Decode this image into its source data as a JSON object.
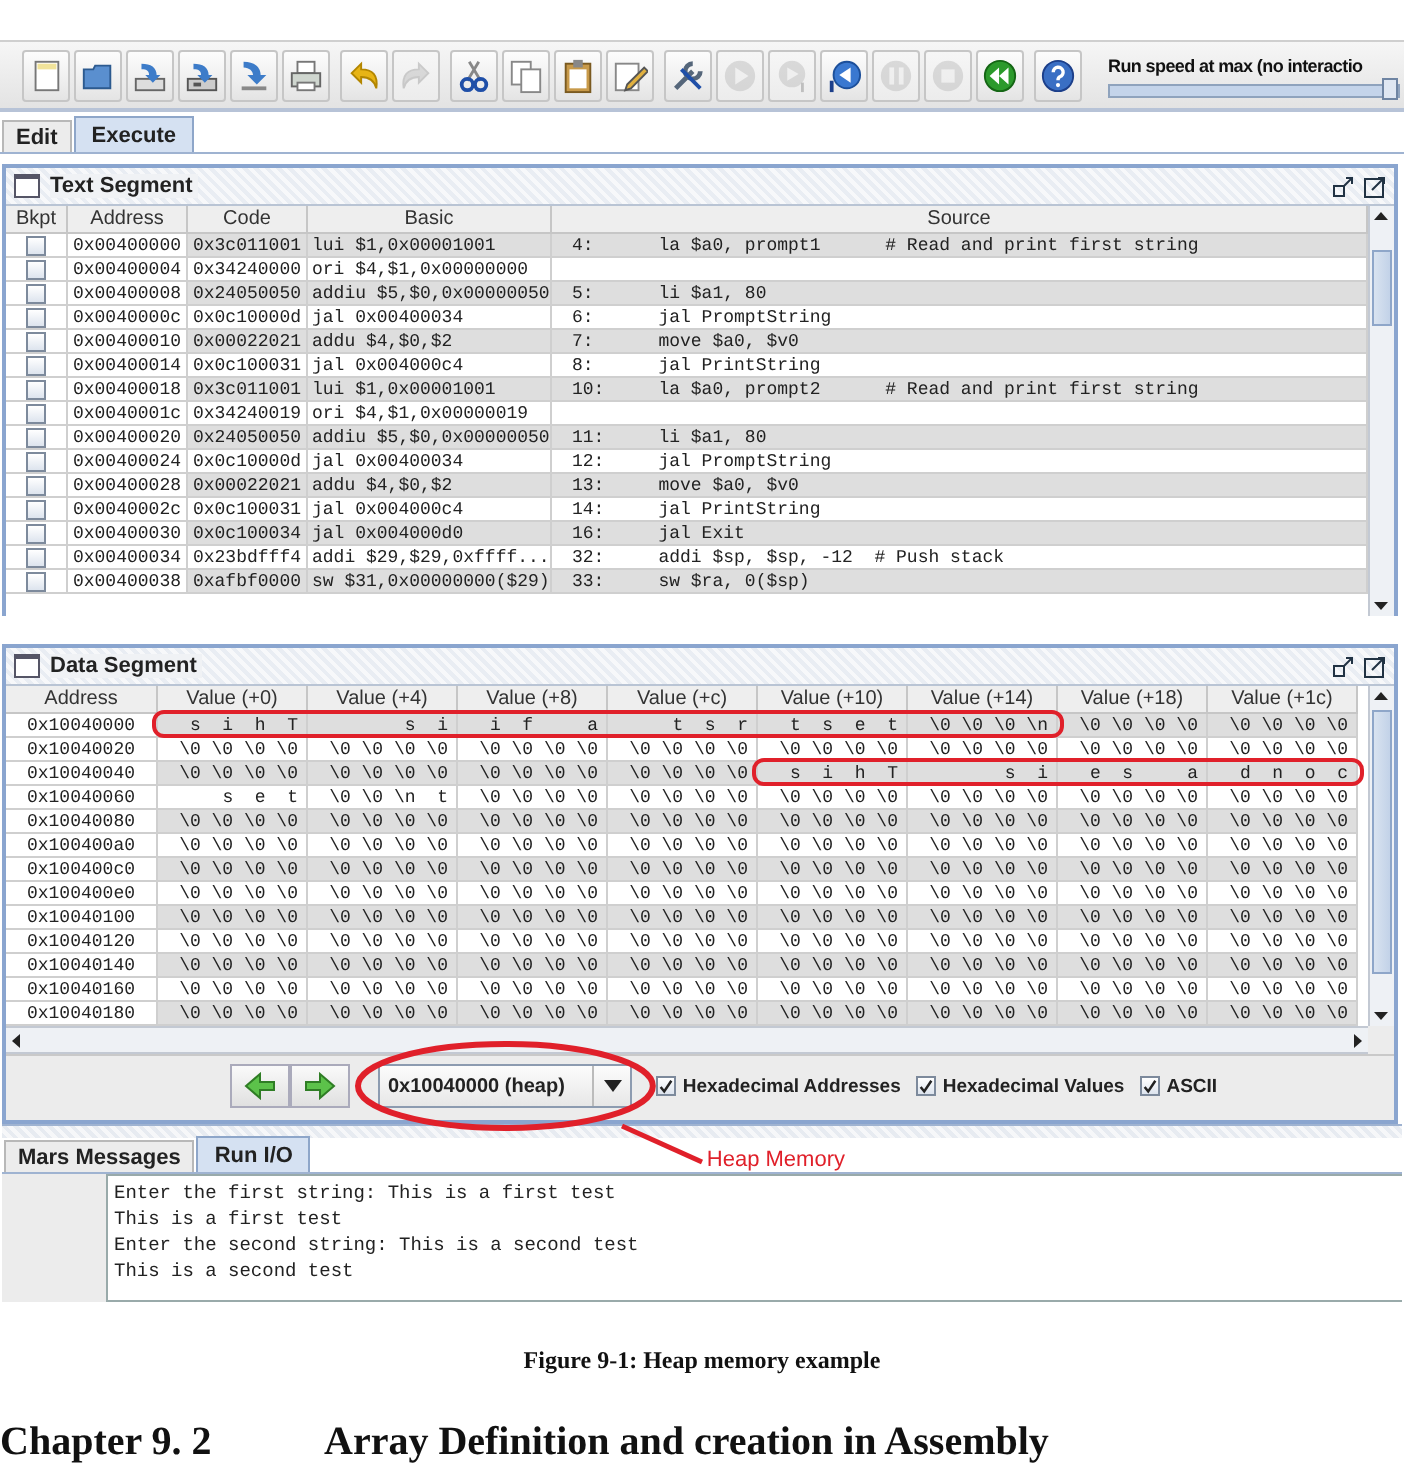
{
  "toolbar": [
    [
      {
        "kind": "new",
        "disabled": false
      },
      {
        "kind": "open",
        "disabled": false
      },
      {
        "kind": "save",
        "disabled": false
      },
      {
        "kind": "save_as",
        "disabled": false
      },
      {
        "kind": "dump",
        "disabled": false
      },
      {
        "kind": "print",
        "disabled": false
      }
    ],
    [
      {
        "kind": "undo",
        "disabled": false
      },
      {
        "kind": "redo",
        "disabled": true
      }
    ],
    [
      {
        "kind": "cut",
        "disabled": false
      },
      {
        "kind": "copy",
        "disabled": false
      },
      {
        "kind": "paste",
        "disabled": false
      },
      {
        "kind": "find",
        "disabled": false
      }
    ],
    [
      {
        "kind": "assemble",
        "disabled": false
      },
      {
        "kind": "run",
        "disabled": true
      },
      {
        "kind": "step",
        "disabled": true
      },
      {
        "kind": "backstep",
        "disabled": false
      },
      {
        "kind": "pause",
        "disabled": true
      },
      {
        "kind": "stop",
        "disabled": true
      },
      {
        "kind": "reset",
        "disabled": false
      }
    ],
    [
      {
        "kind": "help",
        "disabled": false
      }
    ]
  ],
  "speed": {
    "label": "Run speed at max (no interactio",
    "level": 1
  },
  "main_tabs": [
    {
      "label": "Edit",
      "selected": false
    },
    {
      "label": "Execute",
      "selected": true
    }
  ],
  "text_segment": {
    "title": "Text Segment",
    "columns": [
      "Bkpt",
      "Address",
      "Code",
      "Basic",
      "Source"
    ],
    "rows": [
      {
        "breakpoint": false,
        "address": "0x00400000",
        "code": "0x3c011001",
        "basic": "lui $1,0x00001001",
        "source": "4:      la $a0, prompt1      # Read and print first string"
      },
      {
        "breakpoint": false,
        "address": "0x00400004",
        "code": "0x34240000",
        "basic": "ori $4,$1,0x00000000"
      },
      {
        "breakpoint": false,
        "address": "0x00400008",
        "code": "0x24050050",
        "basic": "addiu $5,$0,0x00000050",
        "source": "5:      li $a1, 80"
      },
      {
        "breakpoint": false,
        "address": "0x0040000c",
        "code": "0x0c10000d",
        "basic": "jal 0x00400034",
        "source": "6:      jal PromptString"
      },
      {
        "breakpoint": false,
        "address": "0x00400010",
        "code": "0x00022021",
        "basic": "addu $4,$0,$2",
        "source": "7:      move $a0, $v0"
      },
      {
        "breakpoint": false,
        "address": "0x00400014",
        "code": "0x0c100031",
        "basic": "jal 0x004000c4",
        "source": "8:      jal PrintString"
      },
      {
        "breakpoint": false,
        "address": "0x00400018",
        "code": "0x3c011001",
        "basic": "lui $1,0x00001001",
        "source": "10:     la $a0, prompt2      # Read and print first string"
      },
      {
        "breakpoint": false,
        "address": "0x0040001c",
        "code": "0x34240019",
        "basic": "ori $4,$1,0x00000019"
      },
      {
        "breakpoint": false,
        "address": "0x00400020",
        "code": "0x24050050",
        "basic": "addiu $5,$0,0x00000050",
        "source": "11:     li $a1, 80"
      },
      {
        "breakpoint": false,
        "address": "0x00400024",
        "code": "0x0c10000d",
        "basic": "jal 0x00400034",
        "source": "12:     jal PromptString"
      },
      {
        "breakpoint": false,
        "address": "0x00400028",
        "code": "0x00022021",
        "basic": "addu $4,$0,$2",
        "source": "13:     move $a0, $v0"
      },
      {
        "breakpoint": false,
        "address": "0x0040002c",
        "code": "0x0c100031",
        "basic": "jal 0x004000c4",
        "source": "14:     jal PrintString"
      },
      {
        "breakpoint": false,
        "address": "0x00400030",
        "code": "0x0c100034",
        "basic": "jal 0x004000d0",
        "source": "16:     jal Exit"
      },
      {
        "breakpoint": false,
        "address": "0x00400034",
        "code": "0x23bdfff4",
        "basic": "addi $29,$29,0xffff...",
        "source": "32:     addi $sp, $sp, -12  # Push stack"
      },
      {
        "breakpoint": false,
        "address": "0x00400038",
        "code": "0xafbf0000",
        "basic": "sw $31,0x00000000($29)",
        "source": "33:     sw $ra, 0($sp)"
      }
    ]
  },
  "data_segment": {
    "title": "Data Segment",
    "columns": [
      "Address",
      "Value (+0)",
      "Value (+4)",
      "Value (+8)",
      "Value (+c)",
      "Value (+10)",
      "Value (+14)",
      "Value (+18)",
      "Value (+1c)"
    ],
    "rows": [
      {
        "address": "0x10040000",
        "values": [
          "s  i  h  T",
          "s  i",
          "i  f     a",
          "t  s  r",
          "t  s  e  t",
          "\\0 \\0 \\0 \\n",
          "\\0 \\0 \\0 \\0",
          "\\0 \\0 \\0 \\0"
        ]
      },
      {
        "address": "0x10040020",
        "values": [
          "\\0 \\0 \\0 \\0",
          "\\0 \\0 \\0 \\0",
          "\\0 \\0 \\0 \\0",
          "\\0 \\0 \\0 \\0",
          "\\0 \\0 \\0 \\0",
          "\\0 \\0 \\0 \\0",
          "\\0 \\0 \\0 \\0",
          "\\0 \\0 \\0 \\0"
        ]
      },
      {
        "address": "0x10040040",
        "values": [
          "\\0 \\0 \\0 \\0",
          "\\0 \\0 \\0 \\0",
          "\\0 \\0 \\0 \\0",
          "\\0 \\0 \\0 \\0",
          "s  i  h  T",
          "s  i",
          "e  s     a",
          "d  n  o  c"
        ]
      },
      {
        "address": "0x10040060",
        "values": [
          "s  e  t",
          "\\0 \\0 \\n  t",
          "\\0 \\0 \\0 \\0",
          "\\0 \\0 \\0 \\0",
          "\\0 \\0 \\0 \\0",
          "\\0 \\0 \\0 \\0",
          "\\0 \\0 \\0 \\0",
          "\\0 \\0 \\0 \\0"
        ]
      },
      {
        "address": "0x10040080",
        "values": [
          "\\0 \\0 \\0 \\0",
          "\\0 \\0 \\0 \\0",
          "\\0 \\0 \\0 \\0",
          "\\0 \\0 \\0 \\0",
          "\\0 \\0 \\0 \\0",
          "\\0 \\0 \\0 \\0",
          "\\0 \\0 \\0 \\0",
          "\\0 \\0 \\0 \\0"
        ]
      },
      {
        "address": "0x100400a0",
        "values": [
          "\\0 \\0 \\0 \\0",
          "\\0 \\0 \\0 \\0",
          "\\0 \\0 \\0 \\0",
          "\\0 \\0 \\0 \\0",
          "\\0 \\0 \\0 \\0",
          "\\0 \\0 \\0 \\0",
          "\\0 \\0 \\0 \\0",
          "\\0 \\0 \\0 \\0"
        ]
      },
      {
        "address": "0x100400c0",
        "values": [
          "\\0 \\0 \\0 \\0",
          "\\0 \\0 \\0 \\0",
          "\\0 \\0 \\0 \\0",
          "\\0 \\0 \\0 \\0",
          "\\0 \\0 \\0 \\0",
          "\\0 \\0 \\0 \\0",
          "\\0 \\0 \\0 \\0",
          "\\0 \\0 \\0 \\0"
        ]
      },
      {
        "address": "0x100400e0",
        "values": [
          "\\0 \\0 \\0 \\0",
          "\\0 \\0 \\0 \\0",
          "\\0 \\0 \\0 \\0",
          "\\0 \\0 \\0 \\0",
          "\\0 \\0 \\0 \\0",
          "\\0 \\0 \\0 \\0",
          "\\0 \\0 \\0 \\0",
          "\\0 \\0 \\0 \\0"
        ]
      },
      {
        "address": "0x10040100",
        "values": [
          "\\0 \\0 \\0 \\0",
          "\\0 \\0 \\0 \\0",
          "\\0 \\0 \\0 \\0",
          "\\0 \\0 \\0 \\0",
          "\\0 \\0 \\0 \\0",
          "\\0 \\0 \\0 \\0",
          "\\0 \\0 \\0 \\0",
          "\\0 \\0 \\0 \\0"
        ]
      },
      {
        "address": "0x10040120",
        "values": [
          "\\0 \\0 \\0 \\0",
          "\\0 \\0 \\0 \\0",
          "\\0 \\0 \\0 \\0",
          "\\0 \\0 \\0 \\0",
          "\\0 \\0 \\0 \\0",
          "\\0 \\0 \\0 \\0",
          "\\0 \\0 \\0 \\0",
          "\\0 \\0 \\0 \\0"
        ]
      },
      {
        "address": "0x10040140",
        "values": [
          "\\0 \\0 \\0 \\0",
          "\\0 \\0 \\0 \\0",
          "\\0 \\0 \\0 \\0",
          "\\0 \\0 \\0 \\0",
          "\\0 \\0 \\0 \\0",
          "\\0 \\0 \\0 \\0",
          "\\0 \\0 \\0 \\0",
          "\\0 \\0 \\0 \\0"
        ]
      },
      {
        "address": "0x10040160",
        "values": [
          "\\0 \\0 \\0 \\0",
          "\\0 \\0 \\0 \\0",
          "\\0 \\0 \\0 \\0",
          "\\0 \\0 \\0 \\0",
          "\\0 \\0 \\0 \\0",
          "\\0 \\0 \\0 \\0",
          "\\0 \\0 \\0 \\0",
          "\\0 \\0 \\0 \\0"
        ]
      },
      {
        "address": "0x10040180",
        "values": [
          "\\0 \\0 \\0 \\0",
          "\\0 \\0 \\0 \\0",
          "\\0 \\0 \\0 \\0",
          "\\0 \\0 \\0 \\0",
          "\\0 \\0 \\0 \\0",
          "\\0 \\0 \\0 \\0",
          "\\0 \\0 \\0 \\0",
          "\\0 \\0 \\0 \\0"
        ]
      }
    ],
    "segment_selector": {
      "value": "0x10040000 (heap)"
    },
    "options": [
      {
        "label": "Hexadecimal Addresses",
        "checked": true
      },
      {
        "label": "Hexadecimal Values",
        "checked": true
      },
      {
        "label": "ASCII",
        "checked": true
      }
    ]
  },
  "annotations": {
    "callout": "Heap Memory"
  },
  "message_tabs": [
    {
      "label": "Mars Messages",
      "selected": false
    },
    {
      "label": "Run I/O",
      "selected": true
    }
  ],
  "run_io": {
    "lines": [
      "Enter the first string: This is a first test",
      "This is a first test",
      "Enter the second string: This is a second test",
      "This is a second test"
    ]
  },
  "caption": "Figure 9-1: Heap memory example",
  "heading": {
    "number": "Chapter 9. 2",
    "title": "Array Definition and creation in Assembly"
  }
}
